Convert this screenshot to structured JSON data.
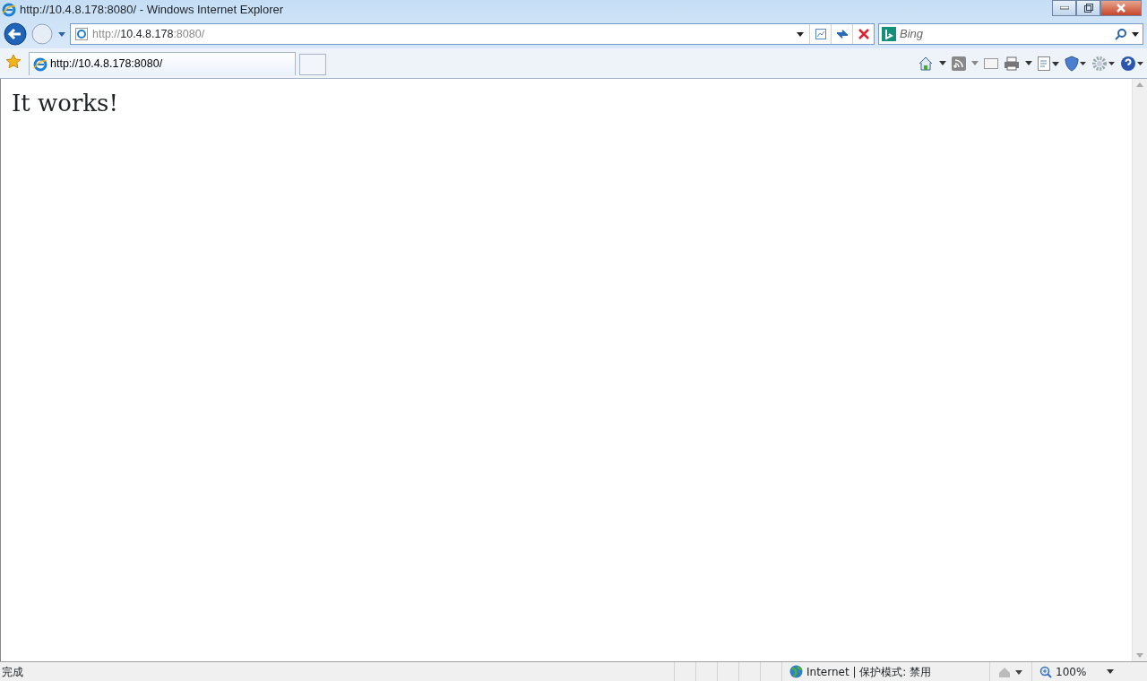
{
  "window": {
    "title": "http://10.4.8.178:8080/ - Windows Internet Explorer"
  },
  "address_bar": {
    "scheme": "http://",
    "host": "10.4.8.178",
    "rest": ":8080/"
  },
  "search": {
    "placeholder": "Bing"
  },
  "tabs": [
    {
      "label": "http://10.4.8.178:8080/",
      "selected": true
    }
  ],
  "page": {
    "heading": "It works!"
  },
  "status_bar": {
    "status": "完成",
    "zone": "Internet | 保护模式: 禁用",
    "zoom": "100%"
  }
}
